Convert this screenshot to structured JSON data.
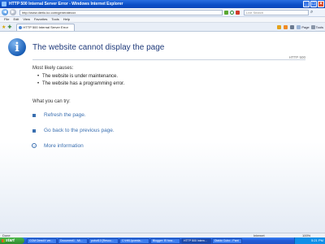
{
  "window": {
    "title": "HTTP 500 Internal Server Error - Windows Internet Explorer"
  },
  "address": {
    "url": "http://www.dietlo.ko.com/generatecox",
    "search_placeholder": "Live Search"
  },
  "menu": [
    "File",
    "Edit",
    "View",
    "Favorites",
    "Tools",
    "Help"
  ],
  "tab": {
    "label": "HTTP 500 Internal Server Error"
  },
  "toolbar": {
    "page_label": "Page",
    "tools_label": "Tools"
  },
  "page": {
    "title": "The website cannot display the page",
    "http_code": "HTTP 500",
    "causes_heading": "Most likely causes:",
    "causes": [
      "The website is under maintenance.",
      "The website has a programming error."
    ],
    "try_heading": "What you can try:",
    "actions": [
      "Refresh the page.",
      "Go back to the previous page.",
      "More information"
    ]
  },
  "status": {
    "left": "Done",
    "zone": "Internet",
    "zoom": "100%"
  },
  "taskbar": {
    "start_label": "start",
    "buttons": [
      "COM DirectX ver...",
      "Document1 - Mi...",
      "pobuf10 [Resou...",
      "C:\\HKL\\pcexta...",
      "Blogger: El fora...",
      "HTTP 500 Intern...",
      "Dlaldo Cubo - Pant"
    ],
    "clock": "5:21 PM"
  },
  "colors": {
    "title_blue": "#1f3a7a",
    "link_blue": "#3a6fb0",
    "xp_blue": "#245edb"
  }
}
